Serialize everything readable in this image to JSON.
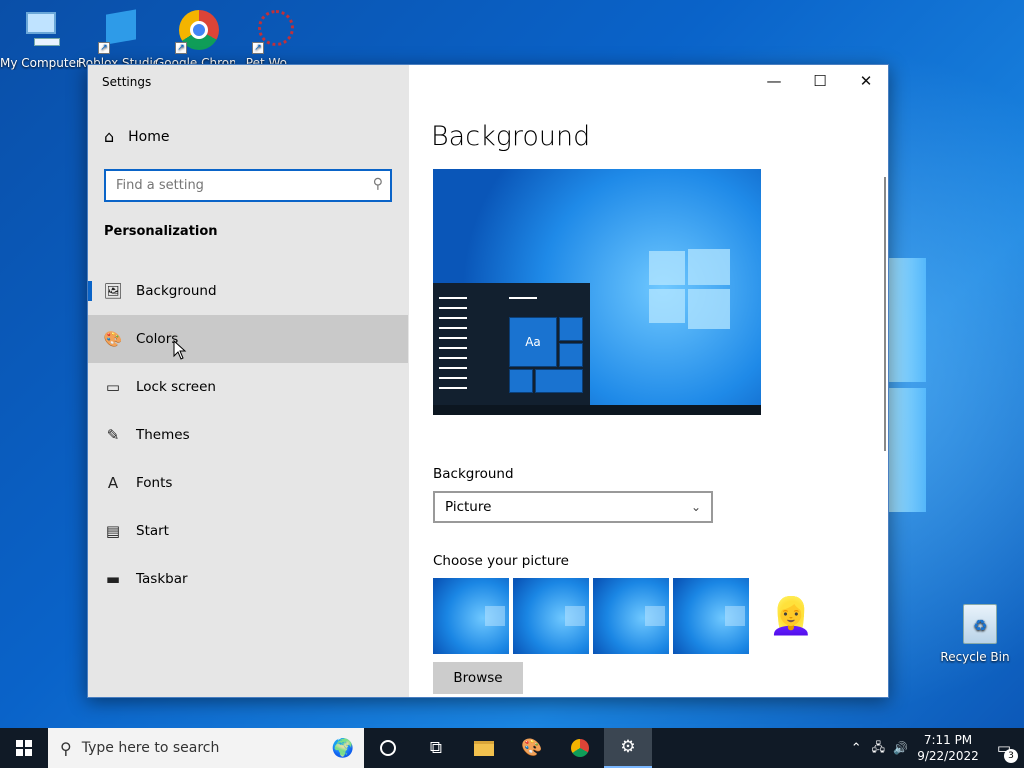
{
  "desktop": {
    "icons": [
      {
        "label": "My Computer"
      },
      {
        "label": "Roblox Studio"
      },
      {
        "label": "Google Chrome"
      },
      {
        "label": "Pet Wo..."
      },
      {
        "label": "Recycle Bin"
      }
    ]
  },
  "window": {
    "title": "Settings",
    "controls": {
      "minimize": "—",
      "maximize": "☐",
      "close": "✕"
    }
  },
  "sidebar": {
    "home_label": "Home",
    "search_placeholder": "Find a setting",
    "section_title": "Personalization",
    "items": [
      {
        "label": "Background",
        "icon": "picture-icon",
        "glyph": "🖼"
      },
      {
        "label": "Colors",
        "icon": "palette-icon",
        "glyph": "🎨"
      },
      {
        "label": "Lock screen",
        "icon": "lock-screen-icon",
        "glyph": "▭"
      },
      {
        "label": "Themes",
        "icon": "themes-icon",
        "glyph": "✎"
      },
      {
        "label": "Fonts",
        "icon": "fonts-icon",
        "glyph": "A"
      },
      {
        "label": "Start",
        "icon": "start-icon",
        "glyph": "▤"
      },
      {
        "label": "Taskbar",
        "icon": "taskbar-icon",
        "glyph": "▬"
      }
    ],
    "active_item": "Background",
    "hovered_item": "Colors"
  },
  "main": {
    "page_title": "Background",
    "preview_tile_text": "Aa",
    "background_label": "Background",
    "background_value": "Picture",
    "choose_label": "Choose your picture",
    "browse_label": "Browse"
  },
  "taskbar": {
    "search_placeholder": "Type here to search",
    "time": "7:11 PM",
    "date": "9/22/2022",
    "notification_count": "3"
  },
  "colors": {
    "accent": "#0a64c8",
    "sidebar_bg": "#e6e6e6",
    "taskbar_bg": "#101a26"
  }
}
